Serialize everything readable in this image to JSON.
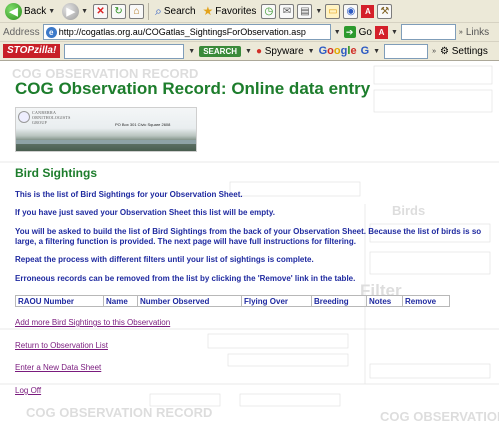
{
  "browser": {
    "toolbar": {
      "back_label": "Back",
      "search_label": "Search",
      "favorites_label": "Favorites",
      "links_label": "Links"
    },
    "address": {
      "label": "Address",
      "url": "http://cogatlas.org.au/COGatlas_SightingsForObservation.asp",
      "go_label": "Go"
    },
    "toolbar2": {
      "brand": "STOPzilla!",
      "search_button": "SEARCH",
      "spyware_label": "Spyware",
      "google_label": "Google",
      "g_label": "G",
      "settings_label": "Settings"
    }
  },
  "page": {
    "title": "COG Observation Record: Online data entry",
    "banner": {
      "org_name_line1": "CANBERRA",
      "org_name_line2": "ORNITHOLOGISTS",
      "org_name_line3": "GROUP",
      "postal_address": "PO Box 301  Civic Square 2608"
    },
    "section_title": "Bird Sightings",
    "paragraphs": [
      "This is the list of Bird Sightings for your Observation Sheet.",
      "If you have just saved your Observation Sheet this list will be empty.",
      "You will be asked to build the list of Bird Sightings from the back of your Observation Sheet. Because the list of birds is so large, a filtering function is provided. The next page will have full instructions for filtering.",
      "Repeat the process with different filters until your list of sightings is complete.",
      "Erroneous records can be removed from the list by clicking the 'Remove' link in the table."
    ],
    "table": {
      "columns": [
        "RAOU Number",
        "Name",
        "Number Observed",
        "Flying Over",
        "Breeding",
        "Notes",
        "Remove"
      ]
    },
    "links": [
      "Add more Bird Sightings to this Observation",
      "Return to Observation List",
      "Enter a New Data Sheet",
      "Log Off"
    ],
    "watermark": {
      "form_title": "COG OBSERVATION RECORD",
      "filter_label": "Filter",
      "birds_label": "Birds"
    }
  },
  "colors": {
    "title_green": "#1d7d2c",
    "text_blue": "#1f2aa0",
    "link_purple": "#7a1b7e"
  }
}
